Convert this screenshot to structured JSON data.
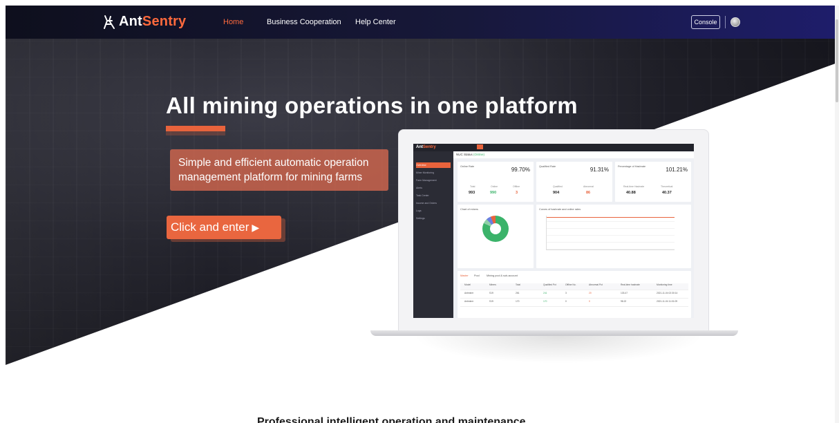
{
  "nav": {
    "logo_prefix": "Ant",
    "logo_accent": "Sentry",
    "links": [
      {
        "label": "Home",
        "active": true
      },
      {
        "label": "Business Cooperation",
        "active": false
      },
      {
        "label": "Help Center",
        "active": false
      }
    ],
    "console_label": "Console"
  },
  "hero": {
    "headline": "All mining operations in one platform",
    "subtitle": "Simple and efficient automatic operation management platform for mining farms",
    "cta_label": "Click and enter",
    "cta_icon": "play-arrow-icon"
  },
  "dashboard": {
    "logo_prefix": "Ant",
    "logo_accent": "Sentry",
    "header_status": "NUC Status",
    "header_value": "(Online)",
    "sidebar": [
      "Overview",
      "Miner Monitoring",
      "Farm Management",
      "Alerts",
      "Task Center",
      "Income and Orders",
      "Logs",
      "Settings"
    ],
    "cards": [
      {
        "title": "Online Rate",
        "value": "99.70%",
        "stats": [
          {
            "label": "Total",
            "value": "993"
          },
          {
            "label": "Online",
            "value": "990"
          },
          {
            "label": "Offline",
            "value": "3"
          }
        ]
      },
      {
        "title": "Qualified Rate",
        "value": "91.31%",
        "stats": [
          {
            "label": "Qualified",
            "value": "904"
          },
          {
            "label": "Abnormal",
            "value": "86"
          }
        ]
      },
      {
        "title": "Percentage of Hashrate",
        "value": "101.21%",
        "stats": [
          {
            "label": "Real-time Hashrate",
            "value": "40.88"
          },
          {
            "label": "Theoretical",
            "value": "40.37"
          }
        ]
      }
    ],
    "chart_titles": [
      "Chart of miners",
      "Curves of hashrate and online rates"
    ],
    "table_tabs": [
      "Master",
      "Pool",
      "Mining pool & sub-account"
    ],
    "table_headers": [
      "Model",
      "Miners",
      "Total",
      "Qualified Pct",
      "Offline No.",
      "Abnormal Pct",
      "Real-time hashrate",
      "Monitoring time"
    ],
    "table_rows": [
      [
        "Antminer",
        "S19",
        "261",
        "241",
        "3",
        "20",
        "133.47",
        "2021-11-04 02:30:14"
      ],
      [
        "Antminer",
        "S19",
        "170",
        "170",
        "0",
        "0",
        "98.22",
        "2021-11-04 11:01:09"
      ]
    ]
  },
  "section": {
    "title": "Professional intelligent operation and maintenance"
  },
  "colors": {
    "accent": "#e8633c",
    "nav_left": "#0e0f1d",
    "nav_right": "#1e1d6b",
    "online_green": "#3bb36a"
  }
}
